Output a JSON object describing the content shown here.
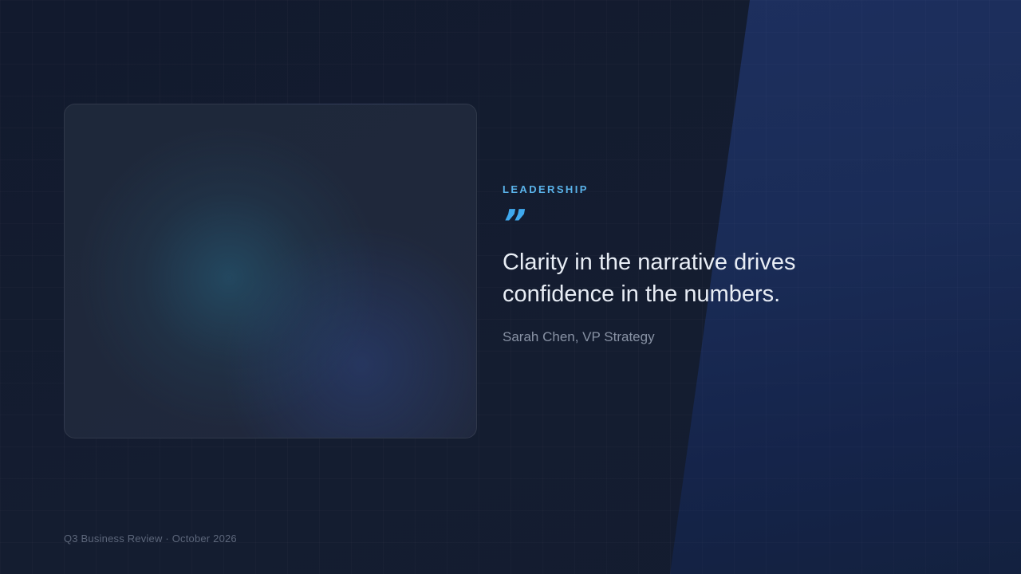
{
  "slide": {
    "eyebrow": "LEADERSHIP",
    "quote_mark": "”",
    "quote_line1": "Clarity in the narrative drives",
    "quote_line2": "confidence in the numbers.",
    "author": "Sarah Chen, VP Strategy",
    "footer": "Q3 Business Review · October 2026"
  },
  "colors": {
    "background": "#121a2e",
    "accent_panel": "#1d2f5e",
    "eyebrow": "#5ab3ea",
    "quote_mark": "#3fa9ee",
    "quote_text": "#e8edf5",
    "author_text": "#8892a4",
    "footer_text": "#5c667a"
  },
  "icons": {
    "quote": "quote-icon"
  }
}
